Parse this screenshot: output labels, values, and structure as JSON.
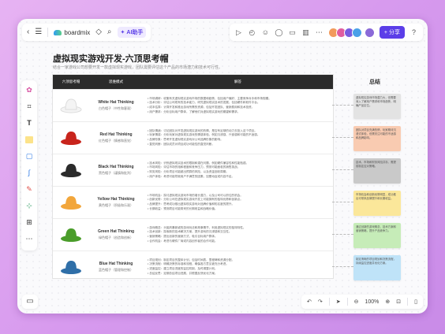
{
  "header": {
    "brand": "boardmix",
    "ai_label": "AI助手",
    "share_label": "分享"
  },
  "doc": {
    "title": "虚拟现实游戏开发-六顶思考帽",
    "subtitle": "结合一家游戏公司想要开发一款虚拟现实游戏，团队需要评估这个产品的市场潜力和技术可行性。"
  },
  "table": {
    "headers": [
      "六顶思考帽",
      "思维模式",
      "解答"
    ],
    "rows": [
      {
        "name": "White Hat Thinking",
        "sub": "白色帽子（中性和客观）",
        "color": "#f4f4f4",
        "lines": [
          "• 市场调研：收集有关虚拟现实游戏市场的数据和趋势，包括用户偏好、主要竞争对手和市场规模。",
          "• 技术分析：评估公司现有的技术能力，研究虚拟现实技术的发展，包括硬件和软件平台。",
          "• 成本估算：计算开发和推出游戏所需的资源，包括开发团队、营销费用和技术投资。",
          "• 用户需求：分析目标用户群体，了解他们对虚拟现实游戏的期望和需求。"
        ]
      },
      {
        "name": "Red Hat Thinking",
        "sub": "红色帽子（情感和直觉）",
        "color": "#c8241c",
        "lines": [
          "• 团队情绪：讨论团队对开发虚拟现实游戏的热情，是否有足够的动力去投入这个项目。",
          "• 玩家情感：分析玩家对虚拟现实游戏的情感体验，例如沉浸感、兴奋感和可能的不适感。",
          "• 品牌形象：思考开发虚拟现实游戏对公司品牌形象的影响。",
          "• 直觉判断：团队成员对项目成功可能性的直觉判断。"
        ]
      },
      {
        "name": "Black Hat Thinking",
        "sub": "黑色帽子（谨慎和批判）",
        "color": "#2b2b2b",
        "lines": [
          "• 技术风险：识别虚拟现实技术的限制和潜在问题，例如硬件兼容性和性能瓶颈。",
          "• 市场风险：评估市场的饱和程度和竞争压力，预测可能面临的销售挑战。",
          "• 财务风险：分析项目可能超出预算的风险，以及资金回收周期。",
          "• 用户体验：考虑可能导致用户不满意的因素，如晕动症或内容不足。"
        ]
      },
      {
        "name": "Yellow Hat Thinking",
        "sub": "黄色帽子（积极和乐观）",
        "color": "#f2a63b",
        "lines": [
          "• 市场机会：探讨虚拟现实游戏市场的增长潜力，以及公司可以抓住的机会。",
          "• 创新优势：分析公司在虚拟现实游戏开发上可能拥有的独特优势和创新点。",
          "• 品牌提升：思考成功推出虚拟现实游戏对品牌价值和知名度的提升。",
          "• 长期收益：预测项目可能带来的长期收益和战略价值。"
        ]
      },
      {
        "name": "Green Hat Thinking",
        "sub": "绿色帽子（创造和创新）",
        "color": "#4a9d2a",
        "lines": [
          "• 游戏概念：头脑风暴新颖的游戏玩法和故事情节，利用虚拟现实的独特特性。",
          "• 技术创新：探索新的技术解决方案，提升游戏的沉浸感和交互性。",
          "• 营销策略：提出创新的营销方式，吸引目标用户群体。",
          "• 合作机会：考虑与硬件厂商或内容创作者的合作可能。"
        ]
      },
      {
        "name": "Blue Hat Thinking",
        "sub": "蓝色帽子（管理和控制）",
        "color": "#2f6fa8",
        "lines": [
          "• 项目规划：制定项目的整体计划，包括时间表、里程碑和资源分配。",
          "• 决策流程：明确决策的标准和流程，确保各方意见被充分考虑。",
          "• 进度监控：建立项目进度的监控机制，及时调整计划。",
          "• 总结反思：定期总结项目进展，并根据反馈优化方案。"
        ]
      }
    ]
  },
  "summary": {
    "title": "总结",
    "notes": [
      {
        "color": "#e3e3e3",
        "text": "虚拟现实游戏市场潜力大，但需要深入了解用户需求和市场趋势，明确产品定位。"
      },
      {
        "color": "#f9cbb1",
        "text": "团队对项目充满热情，玩家期待沉浸式体验，但需关注可能的不适感和品牌影响。"
      },
      {
        "color": "#c9c9c9",
        "text": "技术、市场和财务风险并存，需提前制定应对策略。"
      },
      {
        "color": "#fbe79a",
        "text": "市场机会和创新优势明显，成功推出可带来品牌提升和长期收益。"
      },
      {
        "color": "#c6ecb8",
        "text": "通过创新的游戏概念、技术方案和营销策略，提升产品竞争力。"
      },
      {
        "color": "#bfe3f8",
        "text": "制定清晰的项目规划和决策流程，持续监控进度并优化方案。"
      }
    ]
  },
  "footer": {
    "zoom": "100%"
  },
  "colors": {
    "accent": "#5b3ee8",
    "table_header": "#2b2b2b"
  }
}
